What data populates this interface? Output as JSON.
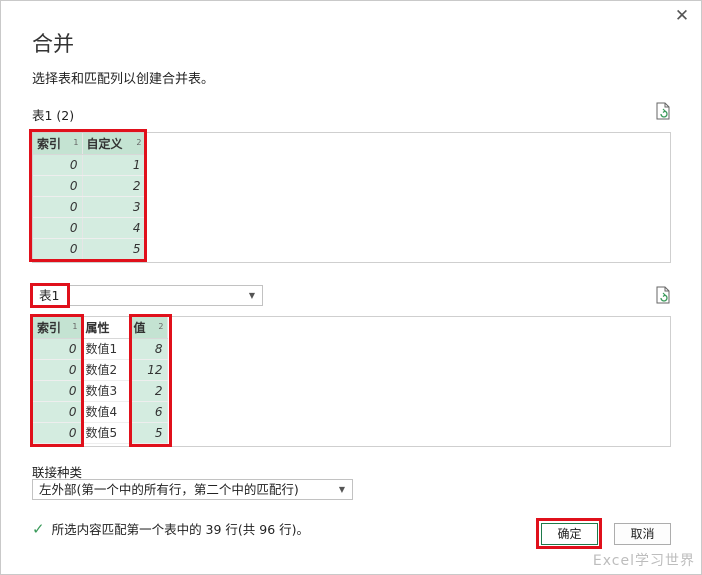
{
  "dialog": {
    "title": "合并",
    "subtitle": "选择表和匹配列以创建合并表。",
    "close_glyph": "✕"
  },
  "table1": {
    "label": "表1 (2)",
    "columns": [
      {
        "name": "索引",
        "index": "1"
      },
      {
        "name": "自定义",
        "index": "2"
      }
    ],
    "rows": [
      [
        "0",
        "1"
      ],
      [
        "0",
        "2"
      ],
      [
        "0",
        "3"
      ],
      [
        "0",
        "4"
      ],
      [
        "0",
        "5"
      ]
    ]
  },
  "table2": {
    "selected": "表1",
    "columns": [
      {
        "name": "索引",
        "index": "1"
      },
      {
        "name": "属性",
        "index": ""
      },
      {
        "name": "值",
        "index": "2"
      }
    ],
    "rows": [
      [
        "0",
        "数值1",
        "8"
      ],
      [
        "0",
        "数值2",
        "12"
      ],
      [
        "0",
        "数值3",
        "2"
      ],
      [
        "0",
        "数值4",
        "6"
      ],
      [
        "0",
        "数值5",
        "5"
      ]
    ]
  },
  "join": {
    "label": "联接种类",
    "value": "左外部(第一个中的所有行，第二个中的匹配行)"
  },
  "status": {
    "text": "所选内容匹配第一个表中的 39 行(共 96 行)。"
  },
  "buttons": {
    "ok": "确定",
    "cancel": "取消"
  },
  "watermark": "Excel学习世界",
  "colors": {
    "selection": "#d4ece0",
    "highlight_border": "#e0101b",
    "check": "#3a9a5a"
  }
}
